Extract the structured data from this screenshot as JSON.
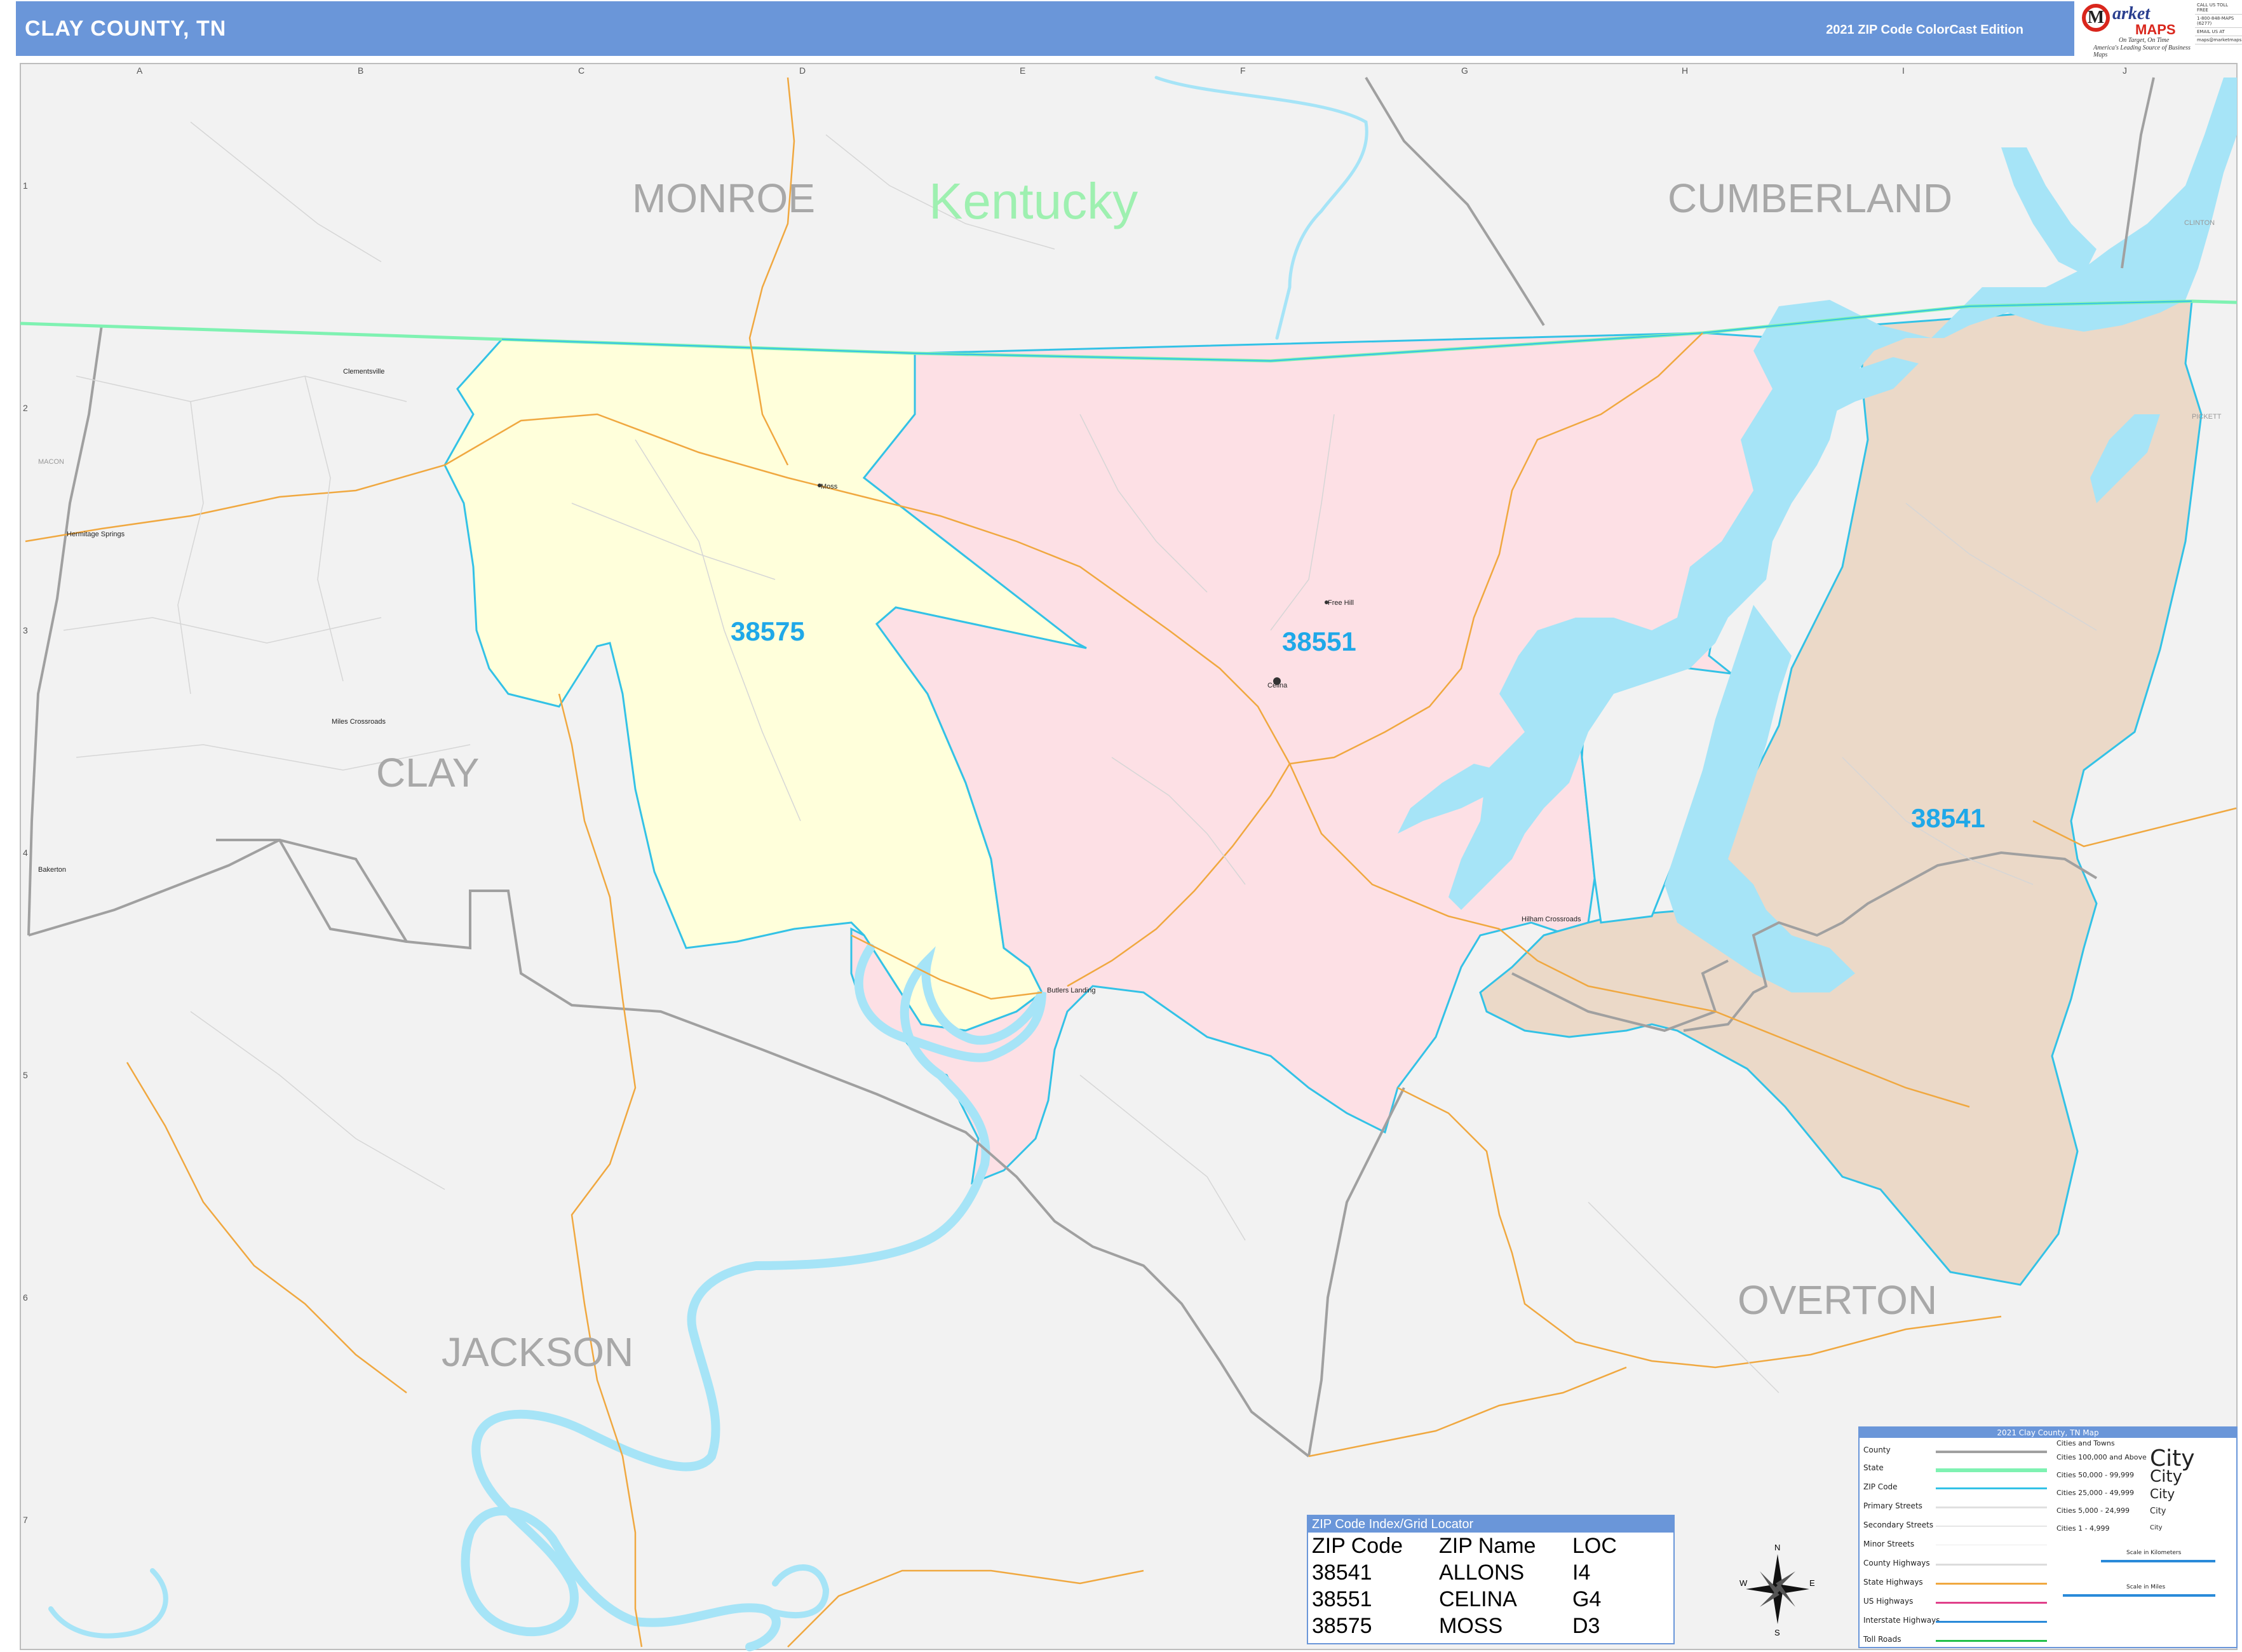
{
  "header": {
    "title": "CLAY COUNTY, TN",
    "edition": "2021 ZIP Code ColorCast Edition"
  },
  "logo": {
    "name_top": "arket",
    "name_bottom": "MAPS",
    "tagline": "On Target, On Time",
    "subtitle": "America's Leading Source of Business Maps"
  },
  "contact": [
    "CALL US TOLL FREE",
    "1-800-848-MAPS (6277)",
    "EMAIL US AT",
    "maps@marketmaps.com"
  ],
  "grid": {
    "columns": [
      "A",
      "B",
      "C",
      "D",
      "E",
      "F",
      "G",
      "H",
      "I",
      "J"
    ],
    "rows": [
      "1",
      "2",
      "3",
      "4",
      "5",
      "6",
      "7"
    ]
  },
  "regions": {
    "state": "Kentucky",
    "counties": [
      "MONROE",
      "CUMBERLAND",
      "CLAY",
      "JACKSON",
      "OVERTON"
    ]
  },
  "zip_areas": [
    {
      "zip": "38575",
      "color": "#ffffdb"
    },
    {
      "zip": "38551",
      "color": "#fde0e5"
    },
    {
      "zip": "38541",
      "color": "#ebd9c8"
    }
  ],
  "places": [
    "Clementsville",
    "MACON",
    "Hermitage Springs",
    "Miles Crossroads",
    "Bakerton",
    "Moss",
    "Free Hill",
    "Celina",
    "Butlers Landing",
    "Hilham Crossroads",
    "CLINTON",
    "PICKETT"
  ],
  "zip_index": {
    "title": "ZIP Code Index/Grid Locator",
    "headers": [
      "ZIP Code",
      "ZIP Name",
      "LOC"
    ],
    "rows": [
      [
        "38541",
        "ALLONS",
        "I4"
      ],
      [
        "38551",
        "CELINA",
        "G4"
      ],
      [
        "38575",
        "MOSS",
        "D3"
      ]
    ]
  },
  "legend": {
    "title": "2021 Clay County, TN Map",
    "items": [
      "County",
      "State",
      "ZIP Code",
      "Primary Streets",
      "Secondary Streets",
      "Minor Streets",
      "County Highways",
      "State Highways",
      "US Highways",
      "Interstate Highways",
      "Toll Roads"
    ],
    "cities_header": "Cities and Towns",
    "cities": [
      {
        "label": "Cities 100,000 and Above",
        "sample": "City"
      },
      {
        "label": "Cities 50,000 - 99,999",
        "sample": "City"
      },
      {
        "label": "Cities 25,000 - 49,999",
        "sample": "City"
      },
      {
        "label": "Cities 5,000 - 24,999",
        "sample": "City"
      },
      {
        "label": "Cities 1 - 4,999",
        "sample": "City"
      }
    ],
    "scale_km": "Scale in Kilometers",
    "scale_mi": "Scale in Miles"
  },
  "compass": {
    "n": "N",
    "s": "S",
    "e": "E",
    "w": "W"
  },
  "colors": {
    "header": "#6a96d9",
    "water": "#a6e4f7",
    "zip_border": "#33c2e6",
    "state_line": "#7ff2b2",
    "county_line": "#a0a0a0",
    "zip_label": "#1fa8e8",
    "state_label": "#9ef0b0",
    "county_label": "#a8a8a8",
    "background": "#f2f2f2",
    "highway": "#f0a840"
  }
}
